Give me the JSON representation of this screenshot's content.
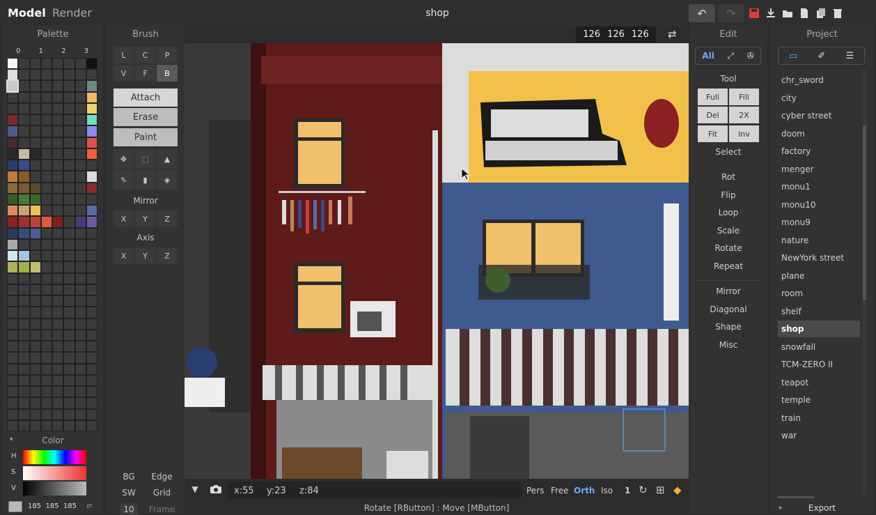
{
  "title": "shop",
  "modes": {
    "model": "Model",
    "render": "Render"
  },
  "toolbar_icons": [
    "undo-icon",
    "redo-icon",
    "save-icon",
    "import-icon",
    "open-folder-icon",
    "new-file-icon",
    "duplicate-icon",
    "delete-icon"
  ],
  "palette": {
    "title": "Palette",
    "cols": [
      "0",
      "1",
      "2",
      "3"
    ]
  },
  "brush": {
    "title": "Brush",
    "modes": [
      "L",
      "C",
      "P",
      "V",
      "F",
      "B"
    ],
    "ops": [
      "Attach",
      "Erase",
      "Paint"
    ],
    "mirror": "Mirror",
    "axis": "Axis",
    "xyz": [
      "X",
      "Y",
      "Z"
    ]
  },
  "size": {
    "x": "126",
    "y": "126",
    "z": "126"
  },
  "color": {
    "title": "Color",
    "h": "H",
    "s": "S",
    "v": "V",
    "value": "185  185  185"
  },
  "bottom_left": {
    "bg": "BG",
    "edge": "Edge",
    "sw": "SW",
    "grid": "Grid",
    "frame_num": "10",
    "frame": "Frame"
  },
  "edit": {
    "title": "Edit",
    "tabs": {
      "all": "All"
    },
    "tool": "Tool",
    "tool_btns": [
      "Full",
      "Fill",
      "Del",
      "2X",
      "Fit",
      "Inv"
    ],
    "select": "Select",
    "items": [
      "Rot",
      "Flip",
      "Loop",
      "Scale",
      "Rotate",
      "Repeat"
    ],
    "items2": [
      "Mirror",
      "Diagonal",
      "Shape",
      "Misc"
    ]
  },
  "project": {
    "title": "Project",
    "files": [
      "chr_sword",
      "city",
      "cyber street",
      "doom",
      "factory",
      "menger",
      "monu1",
      "monu10",
      "monu9",
      "nature",
      "NewYork street",
      "plane",
      "room",
      "shelf",
      "shop",
      "snowfall",
      "TCM-ZERO II",
      "teapot",
      "temple",
      "train",
      "war"
    ],
    "selected": "shop",
    "export": "Export"
  },
  "status": {
    "x": "x:55",
    "y": "y:23",
    "z": "z:84",
    "pers": "Pers",
    "free": "Free",
    "orth": "Orth",
    "iso": "Iso",
    "num": "1",
    "hint": "Rotate [RButton] : Move [MButton]"
  },
  "colors": {
    "accent": "#6fa8ff",
    "red": "#e03b3b"
  }
}
